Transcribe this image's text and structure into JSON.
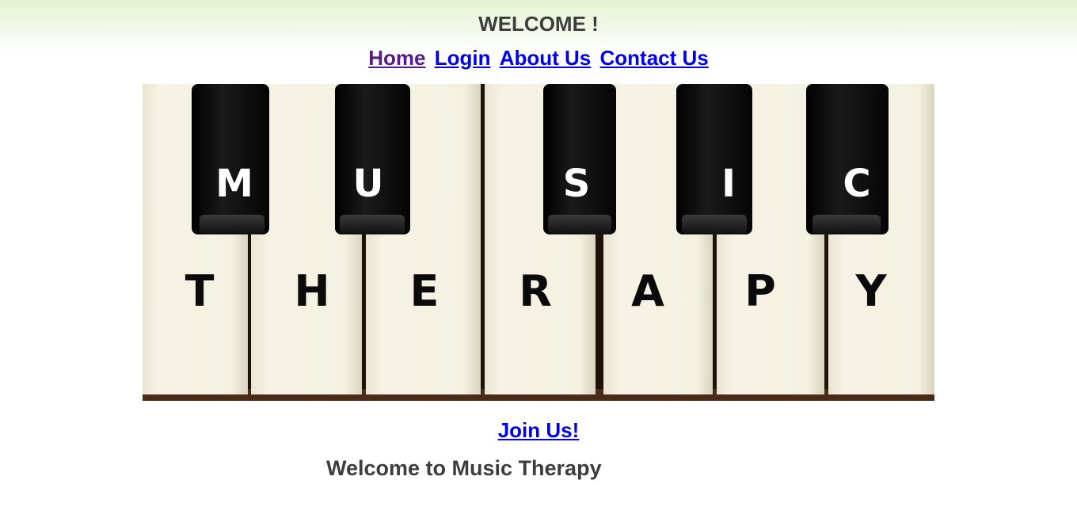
{
  "header": {
    "welcome": "WELCOME !"
  },
  "nav": {
    "items": [
      {
        "label": "Home"
      },
      {
        "label": "Login"
      },
      {
        "label": "About Us"
      },
      {
        "label": "Contact Us"
      }
    ]
  },
  "banner": {
    "black_key_letters": [
      "M",
      "U",
      "S",
      "I",
      "C"
    ],
    "white_key_letters": [
      "T",
      "H",
      "E",
      "R",
      "A",
      "P",
      "Y"
    ]
  },
  "join": {
    "label": "Join Us!"
  },
  "intro": {
    "heading": "Welcome to Music Therapy"
  },
  "colors": {
    "link": "#0000ee",
    "visited_link": "#551a8b",
    "heading_text": "#3d3d3d",
    "top_gradient": "#e6f4d2",
    "ivory_key": "#f3f0df",
    "black_key": "#0b0b0b"
  }
}
